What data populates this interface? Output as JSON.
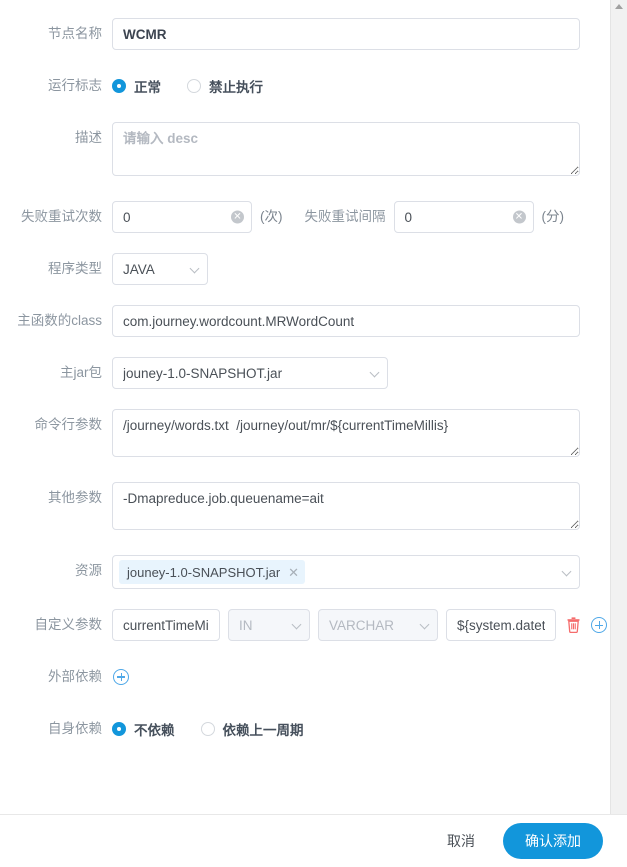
{
  "form": {
    "node_name": {
      "label": "节点名称",
      "value": "WCMR"
    },
    "run_flag": {
      "label": "运行标志",
      "options": [
        {
          "label": "正常",
          "checked": true
        },
        {
          "label": "禁止执行",
          "checked": false
        }
      ]
    },
    "description": {
      "label": "描述",
      "value": "",
      "placeholder": "请输入 desc"
    },
    "retry_times": {
      "label": "失败重试次数",
      "value": "0",
      "unit": "(次)"
    },
    "retry_interval": {
      "label": "失败重试间隔",
      "value": "0",
      "unit": "(分)"
    },
    "program_type": {
      "label": "程序类型",
      "value": "JAVA"
    },
    "main_class": {
      "label": "主函数的class",
      "value": "com.journey.wordcount.MRWordCount"
    },
    "main_jar": {
      "label": "主jar包",
      "value": "jouney-1.0-SNAPSHOT.jar"
    },
    "command_args": {
      "label": "命令行参数",
      "value": "/journey/words.txt  /journey/out/mr/${currentTimeMillis}"
    },
    "other_args": {
      "label": "其他参数",
      "value": "-Dmapreduce.job.queuename=ait"
    },
    "resources": {
      "label": "资源",
      "tags": [
        {
          "text": "jouney-1.0-SNAPSHOT.jar",
          "close": "✕"
        }
      ]
    },
    "custom_params": {
      "label": "自定义参数",
      "rows": [
        {
          "name": "currentTimeMill",
          "direction": "IN",
          "type": "VARCHAR",
          "value": "${system.datet"
        }
      ]
    },
    "external_dependency": {
      "label": "外部依赖"
    },
    "self_dependency": {
      "label": "自身依赖",
      "options": [
        {
          "label": "不依赖",
          "checked": true
        },
        {
          "label": "依赖上一周期",
          "checked": false
        }
      ]
    }
  },
  "footer": {
    "cancel": "取消",
    "confirm": "确认添加"
  },
  "icons": {
    "clear": "✕",
    "plus": "+"
  },
  "colors": {
    "accent": "#1296db",
    "danger": "#f56c6c",
    "label": "#8c96a0",
    "border": "#dcdfe6"
  }
}
